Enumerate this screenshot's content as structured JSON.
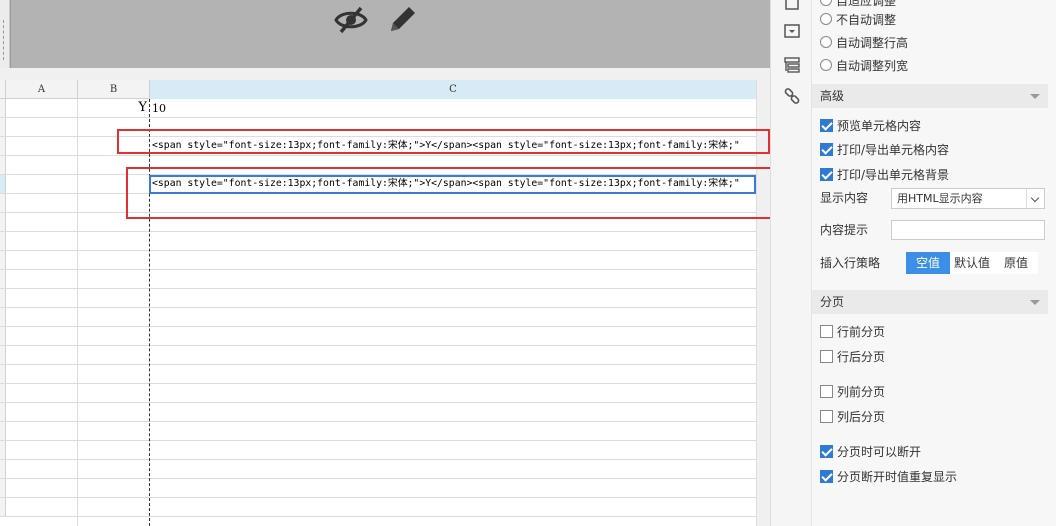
{
  "columns": [
    "A",
    "B",
    "C"
  ],
  "sheet": {
    "b_row_value": "Y",
    "c_row1_value": "10",
    "html_cell_1": "<span style=\"font-size:13px;font-family:宋体;\">Y</span><span style=\"font-size:13px;font-family:宋体;\"",
    "html_cell_2": "<span style=\"font-size:13px;font-family:宋体;\">Y</span><span style=\"font-size:13px;font-family:宋体;\""
  },
  "panel": {
    "radio_partial": "自适应调整",
    "radio_no_adjust": "不自动调整",
    "radio_auto_row": "自动调整行高",
    "radio_auto_col": "自动调整列宽",
    "advanced_section": "高级",
    "cb_preview": "预览单元格内容",
    "cb_print_export": "打印/导出单元格内容",
    "cb_print_bg": "打印/导出单元格背景",
    "display_label": "显示内容",
    "display_value": "用HTML显示内容",
    "tooltip_label": "内容提示",
    "insert_label": "插入行策略",
    "insert_options": [
      "空值",
      "默认值",
      "原值"
    ],
    "insert_selected": "空值",
    "paging_section": "分页",
    "cb_before_row": "行前分页",
    "cb_after_row": "行后分页",
    "cb_before_col": "列前分页",
    "cb_after_col": "列后分页",
    "cb_can_break": "分页时可以断开",
    "cb_repeat": "分页断开时值重复显示"
  },
  "colors": {
    "selection": "#3a7bd5",
    "highlight_box": "#e03030",
    "checkbox_on": "#2f7bd4",
    "segment_active": "#3c8ee6"
  },
  "icons": [
    "eye-slash-icon",
    "pencil-icon",
    "crop-icon",
    "dropdown-box-icon",
    "layers-icon",
    "link-icon"
  ]
}
